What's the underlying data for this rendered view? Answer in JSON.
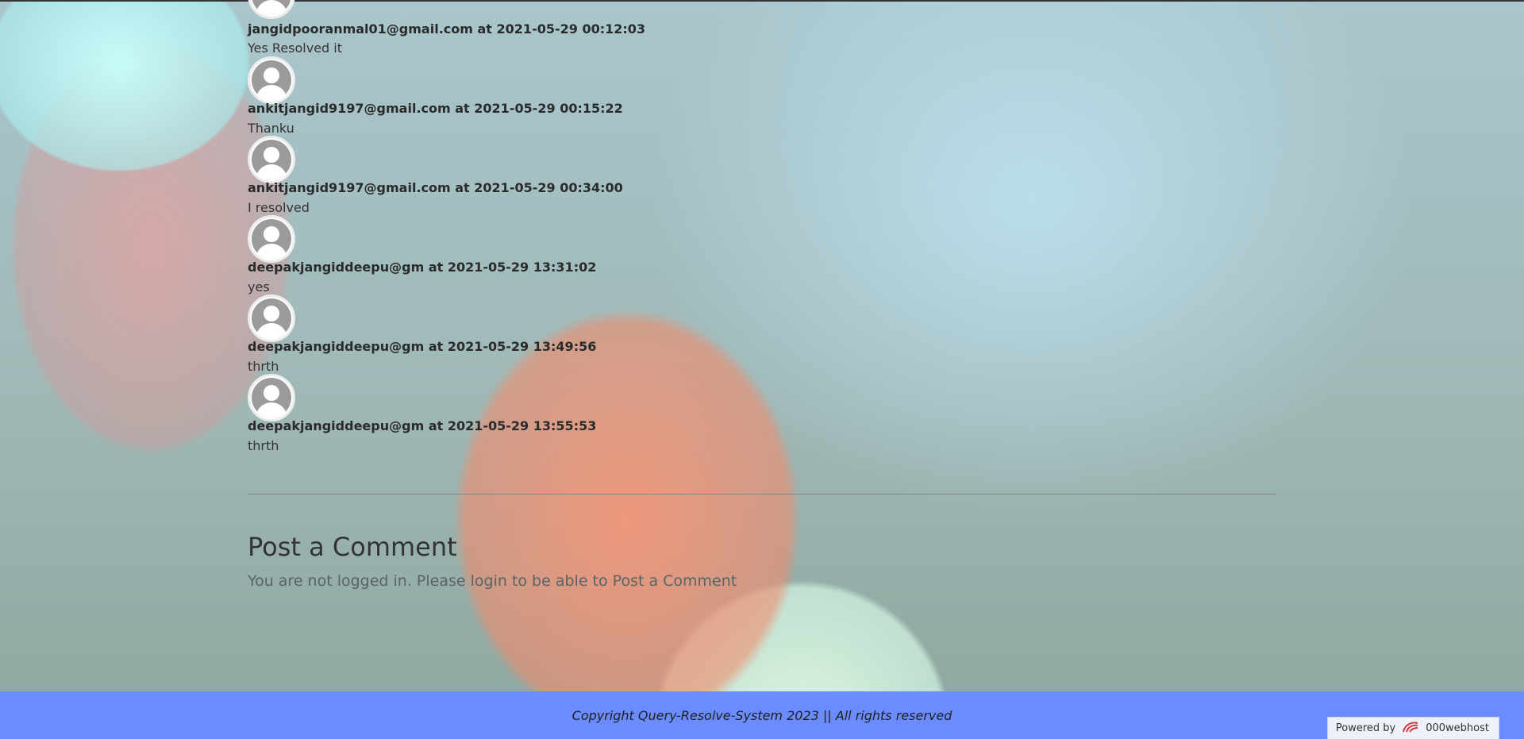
{
  "comments": [
    {
      "author": "jangidpooranmal01@gmail.com",
      "at": "at",
      "time": "2021-05-29 00:12:03",
      "text": "Yes Resolved it"
    },
    {
      "author": "ankitjangid9197@gmail.com",
      "at": "at",
      "time": "2021-05-29 00:15:22",
      "text": "Thanku"
    },
    {
      "author": "ankitjangid9197@gmail.com",
      "at": "at",
      "time": "2021-05-29 00:34:00",
      "text": "I resolved"
    },
    {
      "author": "deepakjangiddeepu@gm",
      "at": "at",
      "time": "2021-05-29 13:31:02",
      "text": "yes"
    },
    {
      "author": "deepakjangiddeepu@gm",
      "at": "at",
      "time": "2021-05-29 13:49:56",
      "text": "thrth"
    },
    {
      "author": "deepakjangiddeepu@gm",
      "at": "at",
      "time": "2021-05-29 13:55:53",
      "text": "thrth"
    }
  ],
  "post_comment": {
    "title": "Post a Comment",
    "note": "You are not logged in. Please login to be able to Post a Comment"
  },
  "footer": {
    "copyright": "Copyright Query-Resolve-System 2023 || All rights reserved",
    "powered_by_label": "Powered by",
    "powered_by_brand": "000webhost"
  },
  "icons": {
    "avatar": "user-avatar-icon",
    "host_logo": "000webhost-logo-icon"
  },
  "colors": {
    "footer_bg": "#6b8cff"
  }
}
